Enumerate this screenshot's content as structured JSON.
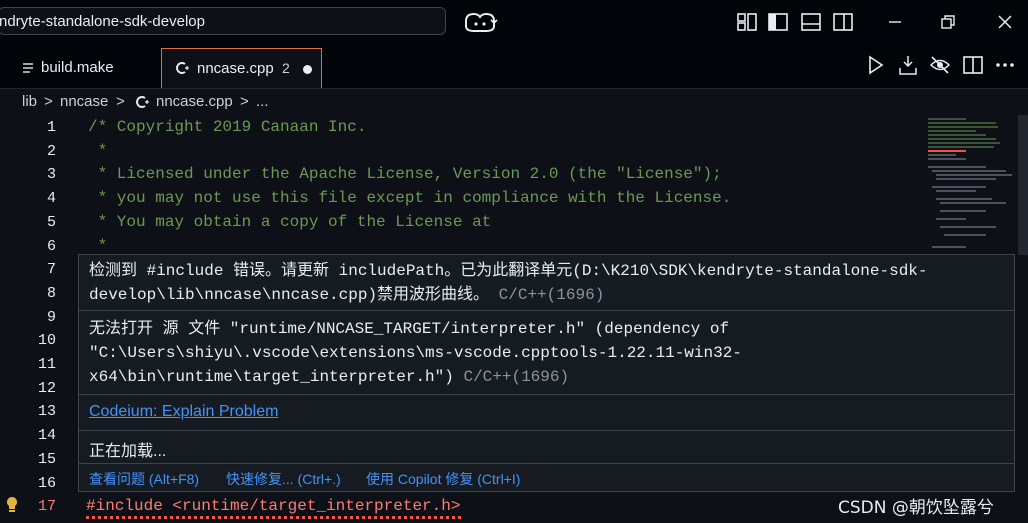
{
  "titlebar": {
    "search_text": "ndryte-standalone-sdk-develop",
    "icons": [
      "copilot-icon",
      "layout-icon",
      "toggle-sidebar-icon",
      "toggle-panel-icon",
      "toggle-secondary-sidebar-icon",
      "minimize-icon",
      "restore-icon",
      "close-icon"
    ]
  },
  "tabs": [
    {
      "label": "build.make",
      "icon": "list-icon"
    },
    {
      "label": "nncase.cpp",
      "badge": "2",
      "icon": "cpp-icon",
      "modified": true
    }
  ],
  "editor_actions": [
    "run-icon",
    "download-icon",
    "eye-off-icon",
    "split-editor-icon",
    "more-icon"
  ],
  "breadcrumb": {
    "items": [
      "lib",
      "nncase",
      "nncase.cpp",
      "..."
    ],
    "separator": ">"
  },
  "code_lines": [
    {
      "n": "1",
      "text": "/* Copyright 2019 Canaan Inc."
    },
    {
      "n": "2",
      "text": " *"
    },
    {
      "n": "3",
      "text": " * Licensed under the Apache License, Version 2.0 (the \"License\");"
    },
    {
      "n": "4",
      "text": " * you may not use this file except in compliance with the License."
    },
    {
      "n": "5",
      "text": " * You may obtain a copy of the License at"
    },
    {
      "n": "6",
      "text": " *"
    },
    {
      "n": "7",
      "text": ""
    },
    {
      "n": "8",
      "text": ""
    },
    {
      "n": "9",
      "text": ""
    },
    {
      "n": "10",
      "text": ""
    },
    {
      "n": "11",
      "text": ""
    },
    {
      "n": "12",
      "text": ""
    },
    {
      "n": "13",
      "text": ""
    },
    {
      "n": "14",
      "text": ""
    },
    {
      "n": "15",
      "text": ""
    },
    {
      "n": "16",
      "text": ""
    }
  ],
  "error_line": {
    "n": "17",
    "text": "#include <runtime/target_interpreter.h>"
  },
  "hover": {
    "problem1": {
      "line1": "检测到 #include 错误。请更新 includePath。已为此翻译单元(D:\\K210\\SDK\\kendryte-standalone-sdk-",
      "line2": "develop\\lib\\nncase\\nncase.cpp)禁用波形曲线。",
      "source": "C/C++(1696)"
    },
    "problem2": {
      "line1": "无法打开 源 文件 \"runtime/NNCASE_TARGET/interpreter.h\" (dependency of",
      "line2": "\"C:\\Users\\shiyu\\.vscode\\extensions\\ms-vscode.cpptools-1.22.11-win32-",
      "line3": "x64\\bin\\runtime\\target_interpreter.h\")",
      "source": "C/C++(1696)"
    },
    "codeium_link": "Codeium: Explain Problem",
    "loading": "正在加载...",
    "actions": [
      "查看问题 (Alt+F8)",
      "快速修复... (Ctrl+.)",
      "使用 Copilot 修复 (Ctrl+I)"
    ]
  },
  "watermark": "CSDN @朝饮坠露兮",
  "colors": {
    "accent_tab_border": "#e06c36",
    "comment": "#6a9955",
    "link": "#4493f8",
    "error": "#f85149"
  }
}
